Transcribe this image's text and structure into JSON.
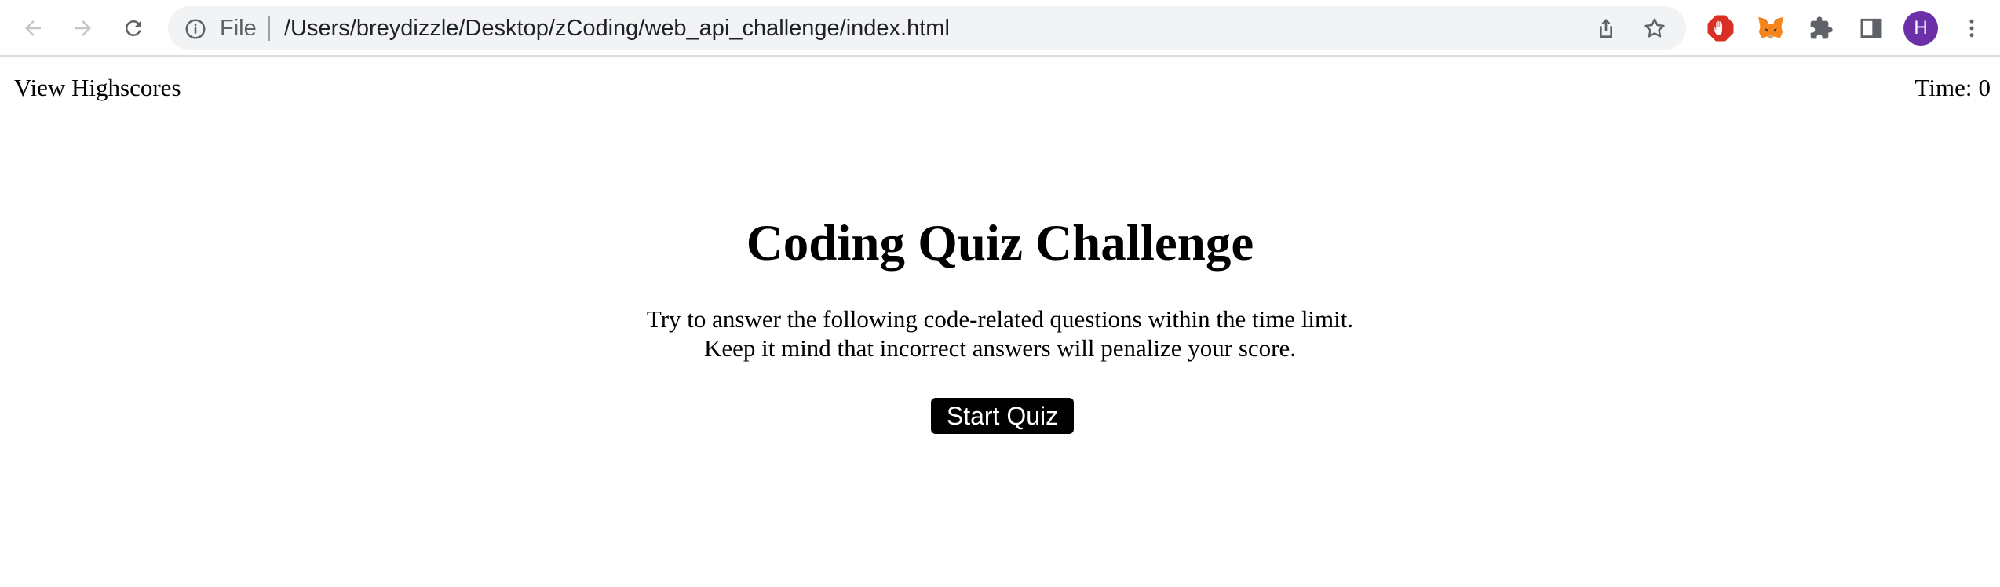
{
  "browser": {
    "omnibox": {
      "scheme_label": "File",
      "url": "/Users/breydizzle/Desktop/zCoding/web_api_challenge/index.html"
    },
    "profile_initial": "H",
    "icons": {
      "back": "back-arrow-icon",
      "forward": "forward-arrow-icon",
      "reload": "reload-icon",
      "info": "info-icon",
      "share": "share-icon",
      "bookmark": "star-icon",
      "adblock": "adblock-hand-icon",
      "metamask": "metamask-fox-icon",
      "extensions": "puzzle-icon",
      "side_panel": "side-panel-icon",
      "menu": "kebab-menu-icon"
    },
    "colors": {
      "toolbar_bg": "#ffffff",
      "omnibox_bg": "#f1f3f4",
      "icon_gray": "#5f6368",
      "avatar_bg": "#6b2fa8",
      "adblock_red": "#d93025",
      "metamask_orange": "#e2761b"
    }
  },
  "page": {
    "header": {
      "highscores_link": "View Highscores",
      "timer_label": "Time:",
      "timer_value": "0"
    },
    "main": {
      "title": "Coding Quiz Challenge",
      "intro_line_1": "Try to answer the following code-related questions within the time limit.",
      "intro_line_2": "Keep it mind that incorrect answers will penalize your score.",
      "start_button": "Start Quiz"
    },
    "colors": {
      "button_bg": "#000000",
      "button_text": "#ffffff",
      "text": "#000000"
    }
  }
}
